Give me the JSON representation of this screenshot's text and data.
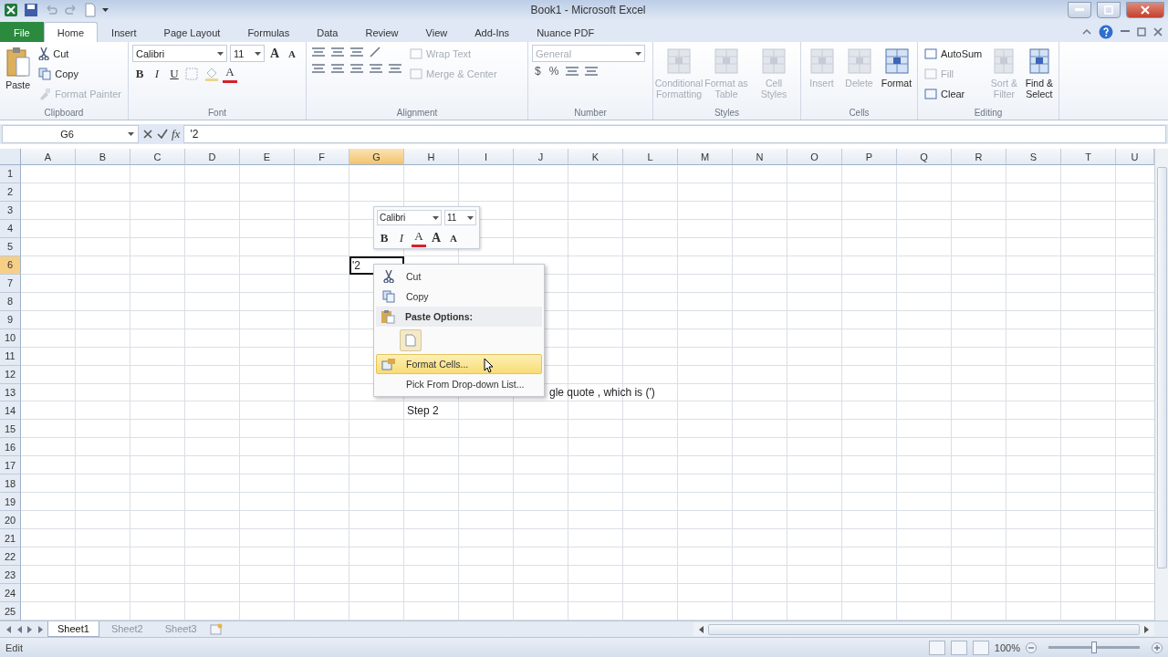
{
  "window": {
    "title": "Book1 - Microsoft Excel"
  },
  "ribbon_tabs": [
    {
      "label": "File",
      "kind": "file",
      "selected": false
    },
    {
      "label": "Home",
      "kind": "tab",
      "selected": true
    },
    {
      "label": "Insert",
      "kind": "tab",
      "selected": false
    },
    {
      "label": "Page Layout",
      "kind": "tab",
      "selected": false
    },
    {
      "label": "Formulas",
      "kind": "tab",
      "selected": false
    },
    {
      "label": "Data",
      "kind": "tab",
      "selected": false
    },
    {
      "label": "Review",
      "kind": "tab",
      "selected": false
    },
    {
      "label": "View",
      "kind": "tab",
      "selected": false
    },
    {
      "label": "Add-Ins",
      "kind": "tab",
      "selected": false
    },
    {
      "label": "Nuance PDF",
      "kind": "tab",
      "selected": false
    }
  ],
  "ribbon": {
    "clipboard": {
      "label": "Clipboard",
      "paste": "Paste",
      "commands": [
        {
          "label": "Cut",
          "disabled": false
        },
        {
          "label": "Copy",
          "disabled": false
        },
        {
          "label": "Format Painter",
          "disabled": true
        }
      ]
    },
    "font": {
      "label": "Font",
      "font_name": "Calibri",
      "font_size": "11",
      "top_buttons": [
        {
          "label": "A",
          "kind": "grow"
        },
        {
          "label": "A",
          "kind": "shrink"
        }
      ],
      "bottom_buttons": [
        {
          "label": "B",
          "kind": "bold"
        },
        {
          "label": "I",
          "kind": "italic"
        },
        {
          "label": "U",
          "kind": "underline"
        },
        {
          "kind": "borders"
        },
        {
          "kind": "fill"
        },
        {
          "label": "A",
          "kind": "color"
        }
      ]
    },
    "alignment": {
      "label": "Alignment",
      "commands": [
        {
          "label": "Wrap Text",
          "disabled": true
        },
        {
          "label": "Merge & Center",
          "disabled": true
        }
      ]
    },
    "number": {
      "label": "Number",
      "format": "General",
      "symbols": [
        "$",
        "%"
      ]
    },
    "styles": {
      "label": "Styles",
      "commands": [
        {
          "label": "Conditional Formatting",
          "disabled": true
        },
        {
          "label": "Format as Table",
          "disabled": true
        },
        {
          "label": "Cell Styles",
          "disabled": true
        }
      ]
    },
    "cells": {
      "label": "Cells",
      "commands": [
        {
          "label": "Insert",
          "disabled": true
        },
        {
          "label": "Delete",
          "disabled": true
        },
        {
          "label": "Format",
          "disabled": false
        }
      ]
    },
    "editing": {
      "label": "Editing",
      "small_commands": [
        {
          "label": "AutoSum",
          "disabled": false
        },
        {
          "label": "Fill",
          "disabled": true
        },
        {
          "label": "Clear",
          "disabled": false
        }
      ],
      "large_commands": [
        {
          "label": "Sort & Filter",
          "disabled": true
        },
        {
          "label": "Find & Select",
          "disabled": false
        }
      ]
    }
  },
  "formula_bar": {
    "name_box": "G6",
    "function_label": "fx",
    "formula": "'2"
  },
  "columns": [
    {
      "label": "A",
      "selected": false
    },
    {
      "label": "B",
      "selected": false
    },
    {
      "label": "C",
      "selected": false
    },
    {
      "label": "D",
      "selected": false
    },
    {
      "label": "E",
      "selected": false
    },
    {
      "label": "F",
      "selected": false
    },
    {
      "label": "G",
      "selected": true
    },
    {
      "label": "H",
      "selected": false
    },
    {
      "label": "I",
      "selected": false
    },
    {
      "label": "J",
      "selected": false
    },
    {
      "label": "K",
      "selected": false
    },
    {
      "label": "L",
      "selected": false
    },
    {
      "label": "M",
      "selected": false
    },
    {
      "label": "N",
      "selected": false
    },
    {
      "label": "O",
      "selected": false
    },
    {
      "label": "P",
      "selected": false
    },
    {
      "label": "Q",
      "selected": false
    },
    {
      "label": "R",
      "selected": false
    },
    {
      "label": "S",
      "selected": false
    },
    {
      "label": "T",
      "selected": false
    },
    {
      "label": "U",
      "selected": false
    }
  ],
  "rows": [
    {
      "label": "1",
      "selected": false
    },
    {
      "label": "2",
      "selected": false
    },
    {
      "label": "3",
      "selected": false
    },
    {
      "label": "4",
      "selected": false
    },
    {
      "label": "5",
      "selected": false
    },
    {
      "label": "6",
      "selected": true
    },
    {
      "label": "7",
      "selected": false
    },
    {
      "label": "8",
      "selected": false
    },
    {
      "label": "9",
      "selected": false
    },
    {
      "label": "10",
      "selected": false
    },
    {
      "label": "11",
      "selected": false
    },
    {
      "label": "12",
      "selected": false
    },
    {
      "label": "13",
      "selected": false
    },
    {
      "label": "14",
      "selected": false
    },
    {
      "label": "15",
      "selected": false
    },
    {
      "label": "16",
      "selected": false
    },
    {
      "label": "17",
      "selected": false
    },
    {
      "label": "18",
      "selected": false
    },
    {
      "label": "19",
      "selected": false
    },
    {
      "label": "20",
      "selected": false
    },
    {
      "label": "21",
      "selected": false
    },
    {
      "label": "22",
      "selected": false
    },
    {
      "label": "23",
      "selected": false
    },
    {
      "label": "24",
      "selected": false
    },
    {
      "label": "25",
      "selected": false
    }
  ],
  "cells": [
    {
      "text": "'2",
      "selected": true
    },
    {
      "text": "gle quote , which is (')",
      "selected": false
    },
    {
      "text": "Step 2",
      "selected": false
    }
  ],
  "mini_toolbar": {
    "font_name": "Calibri",
    "font_size": "11",
    "buttons": [
      {
        "label": "B",
        "kind": "bold"
      },
      {
        "label": "I",
        "kind": "italic"
      },
      {
        "label": "A",
        "kind": "color"
      },
      {
        "label": "A",
        "kind": "grow"
      },
      {
        "label": "A",
        "kind": "shrink"
      }
    ]
  },
  "context_menu": {
    "items": [
      {
        "label": "Cut",
        "kind": "command",
        "selected": false
      },
      {
        "label": "Copy",
        "kind": "command",
        "selected": false
      },
      {
        "label": "Paste Options:",
        "kind": "header"
      },
      {
        "kind": "paste_buttons"
      },
      {
        "label": "Format Cells...",
        "kind": "command",
        "selected": true
      },
      {
        "label": "Pick From Drop-down List...",
        "kind": "command",
        "selected": false
      }
    ]
  },
  "sheet_tabs": [
    {
      "label": "Sheet1",
      "selected": true
    },
    {
      "label": "Sheet2",
      "selected": false
    },
    {
      "label": "Sheet3",
      "selected": false
    }
  ],
  "status_bar": {
    "mode": "Edit",
    "zoom": {
      "label": "100%",
      "level": 0.5
    }
  }
}
